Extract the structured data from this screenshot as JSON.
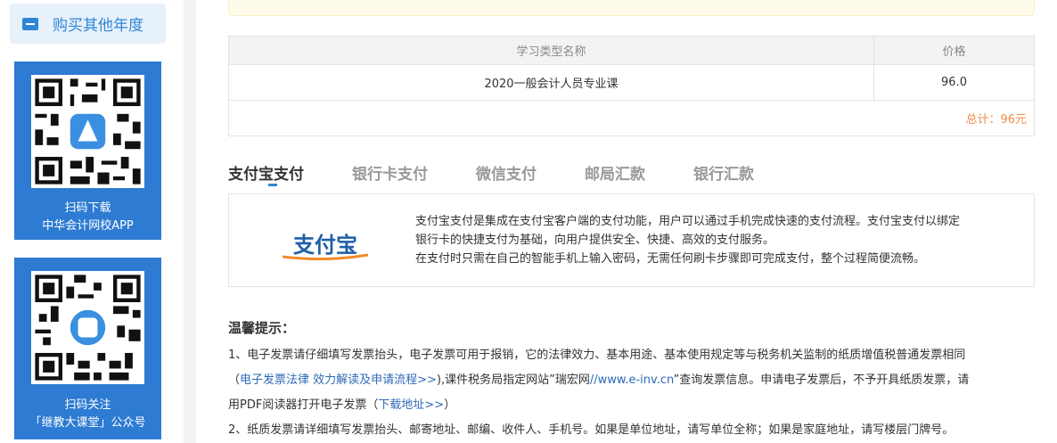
{
  "sidebar": {
    "buy_other_year": "购买其他年度",
    "card1": {
      "line1": "扫码下载",
      "line2": "中华会计网校APP"
    },
    "card2": {
      "line1": "扫码关注",
      "line2": "「继教大课堂」公众号"
    }
  },
  "order_table": {
    "headers": [
      "学习类型名称",
      "价格"
    ],
    "rows": [
      {
        "name": "2020一般会计人员专业课",
        "price": "96.0"
      }
    ],
    "total": "总计：96元"
  },
  "pay_tabs": [
    "支付宝支付",
    "银行卡支付",
    "微信支付",
    "邮局汇款",
    "银行汇款"
  ],
  "alipay": {
    "logo_text": "支付宝",
    "description": [
      "支付宝支付是集成在支付宝客户端的支付功能，用户可以通过手机完成快速的支付流程。支付宝支付以绑定",
      "银行卡的快捷支付为基础，向用户提供安全、快捷、高效的支付服务。",
      "在支付时只需在自己的智能手机上输入密码，无需任何刷卡步骤即可完成支付，整个过程简便流畅。"
    ]
  },
  "tips": {
    "title": "温馨提示：",
    "item1_a": "1、电子发票请仔细填写发票抬头，电子发票可用于报销，它的法律效力、基本用途、基本使用规定等与税务机关监制的纸质增值税普通发票相同",
    "item1_b_pre": "（",
    "item1_b_link": "电子发票法律 效力解读及申请流程>>",
    "item1_b_post": "),课件税务局指定网站”瑞宏网",
    "item1_b_site": "//www.e-inv.cn",
    "item1_b_tail": "”查询发票信息。申请电子发票后，不予开具纸质发票，请",
    "item1_c_pre": "用PDF阅读器打开电子发票（",
    "item1_c_link": "下载地址>>",
    "item1_c_post": "）",
    "item2": "2、纸质发票请详细填写发票抬头、邮寄地址、邮编、收件人、手机号。如果是单位地址，请写单位全称；如果是家庭地址，请写楼层门牌号。"
  },
  "colors": {
    "accent": "#2f86d6",
    "total": "#f08c4a",
    "link": "#2f6ab8"
  }
}
